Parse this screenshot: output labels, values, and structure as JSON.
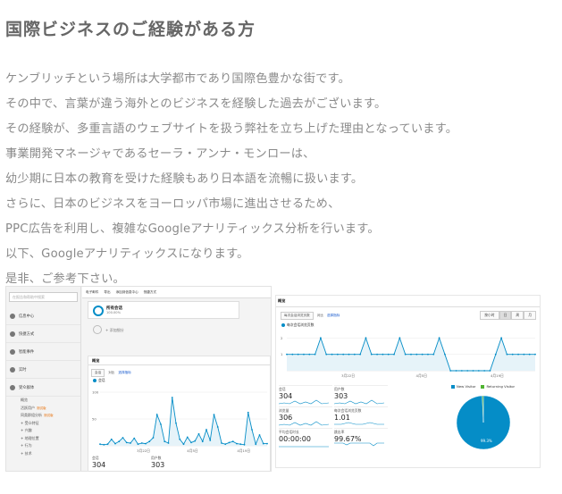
{
  "heading": "国際ビジネスのご経験がある方",
  "paragraph_lines": [
    "ケンブリッチという場所は大学都市であり国際色豊かな街です。",
    "その中で、言葉が違う海外とのビジネスを経験した過去がございます。",
    "その経験が、多重言語のウェブサイトを扱う弊社を立ち上げた理由となっています。",
    "事業開発マネージャであるセーラ・アンナ・モンローは、",
    "幼少期に日本の教育を受けた経験もあり日本語を流暢に扱います。",
    "さらに、日本のビジネスをヨーロッパ市場に進出させるため、",
    "PPC広告を利用し、複雑なGoogleアナリティックス分析を行います。",
    "以下、Googleアナリティックスになります。",
    "是非、ご参考下さい。"
  ],
  "left_shot": {
    "search_placeholder": "在报告和帮助中搜索",
    "top_menu": [
      "电子邮件",
      "导出",
      "添加到信息中心",
      "快捷方式"
    ],
    "nav_items": [
      {
        "label": "信息中心",
        "icon": "dashboard-icon"
      },
      {
        "label": "快捷方式",
        "icon": "shortcut-icon"
      },
      {
        "label": "智能事件",
        "icon": "lightbulb-icon"
      },
      {
        "label": "实时",
        "icon": "clock-icon"
      },
      {
        "label": "受众群体",
        "icon": "people-icon"
      }
    ],
    "sub_items": [
      {
        "label": "概览",
        "badge": ""
      },
      {
        "label": "活跃用户",
        "badge": "测试版"
      },
      {
        "label": "同类群组分析",
        "badge": "测试版"
      },
      {
        "label": "+ 受众特征",
        "badge": ""
      },
      {
        "label": "+ 兴趣",
        "badge": ""
      },
      {
        "label": "+ 地理位置",
        "badge": ""
      },
      {
        "label": "+ 行为",
        "badge": ""
      },
      {
        "label": "+ 技术",
        "badge": ""
      }
    ],
    "segment_label": "所有会话",
    "segment_value": "100.00%",
    "add_segment": "+ 添加细分",
    "panel_tab": "概览",
    "metric_select": "会话",
    "vs_label": "对比",
    "select_metric_link": "选择指标",
    "legend": "会话",
    "y_ticks": [
      "100",
      "50"
    ],
    "x_ticks": [
      "3月22日",
      "4月5日",
      "4月19日"
    ],
    "metrics": [
      {
        "label": "会话",
        "value": "304"
      },
      {
        "label": "用户数",
        "value": "303"
      }
    ],
    "accent_color": "#058dc7"
  },
  "right_shot": {
    "tab": "概览",
    "metric_select": "每次会话浏览页数",
    "vs_label": "对比",
    "select_metric_link": "选择指标",
    "view_buttons": [
      "按小时",
      "日",
      "周",
      "月"
    ],
    "view_selected": "日",
    "legend": "每次会话浏览页数",
    "y_ticks": [
      "2",
      "1"
    ],
    "x_ticks": [
      "3月22日",
      "4月5日",
      "4月19日"
    ],
    "metrics": [
      {
        "label": "会话",
        "value": "304"
      },
      {
        "label": "用户数",
        "value": "303"
      },
      {
        "label": "浏览量",
        "value": "306"
      },
      {
        "label": "每次会话浏览页数",
        "value": "1.01"
      },
      {
        "label": "平均会话时长",
        "value": "00:00:00"
      },
      {
        "label": "跳出率",
        "value": "99.67%"
      }
    ],
    "pie_legend": [
      {
        "label": "New Visitor",
        "color": "#058dc7"
      },
      {
        "label": "Returning Visitor",
        "color": "#50b432"
      }
    ],
    "pie_label": "99.3%"
  },
  "chart_data": [
    {
      "type": "area",
      "ylim": [
        0,
        110
      ],
      "values": [
        3,
        2,
        3,
        12,
        4,
        8,
        15,
        6,
        5,
        14,
        3,
        5,
        4,
        8,
        15,
        58,
        40,
        8,
        5,
        90,
        42,
        12,
        3,
        16,
        6,
        9,
        22,
        8,
        30,
        10,
        58,
        35,
        5,
        3,
        6,
        8,
        4,
        3,
        2,
        62,
        30,
        3,
        20,
        4,
        4
      ],
      "yticks": [
        100,
        50
      ],
      "xticks": [
        "3月22日",
        "4月5日",
        "4月19日"
      ],
      "legend": "会话",
      "grid": true
    },
    {
      "type": "area",
      "ylim": [
        0,
        2.4
      ],
      "values": [
        1,
        1,
        1,
        1,
        1,
        1,
        2,
        1,
        1,
        1,
        1,
        1,
        1,
        1,
        2,
        1,
        1,
        1,
        1,
        1,
        2,
        1,
        1,
        1,
        1,
        1,
        1,
        2,
        1,
        0,
        0,
        0,
        0,
        0,
        0,
        0,
        0,
        1,
        2,
        1,
        1,
        1,
        1,
        1,
        1
      ],
      "yticks": [
        2,
        1
      ],
      "xticks": [
        "3月22日",
        "4月5日",
        "4月19日"
      ],
      "legend": "每次会话浏览页数",
      "grid": true
    },
    {
      "type": "pie",
      "categories": [
        "New Visitor",
        "Returning Visitor"
      ],
      "values": [
        99.3,
        0.7
      ],
      "colors": [
        "#058dc7",
        "#50b432"
      ]
    }
  ]
}
